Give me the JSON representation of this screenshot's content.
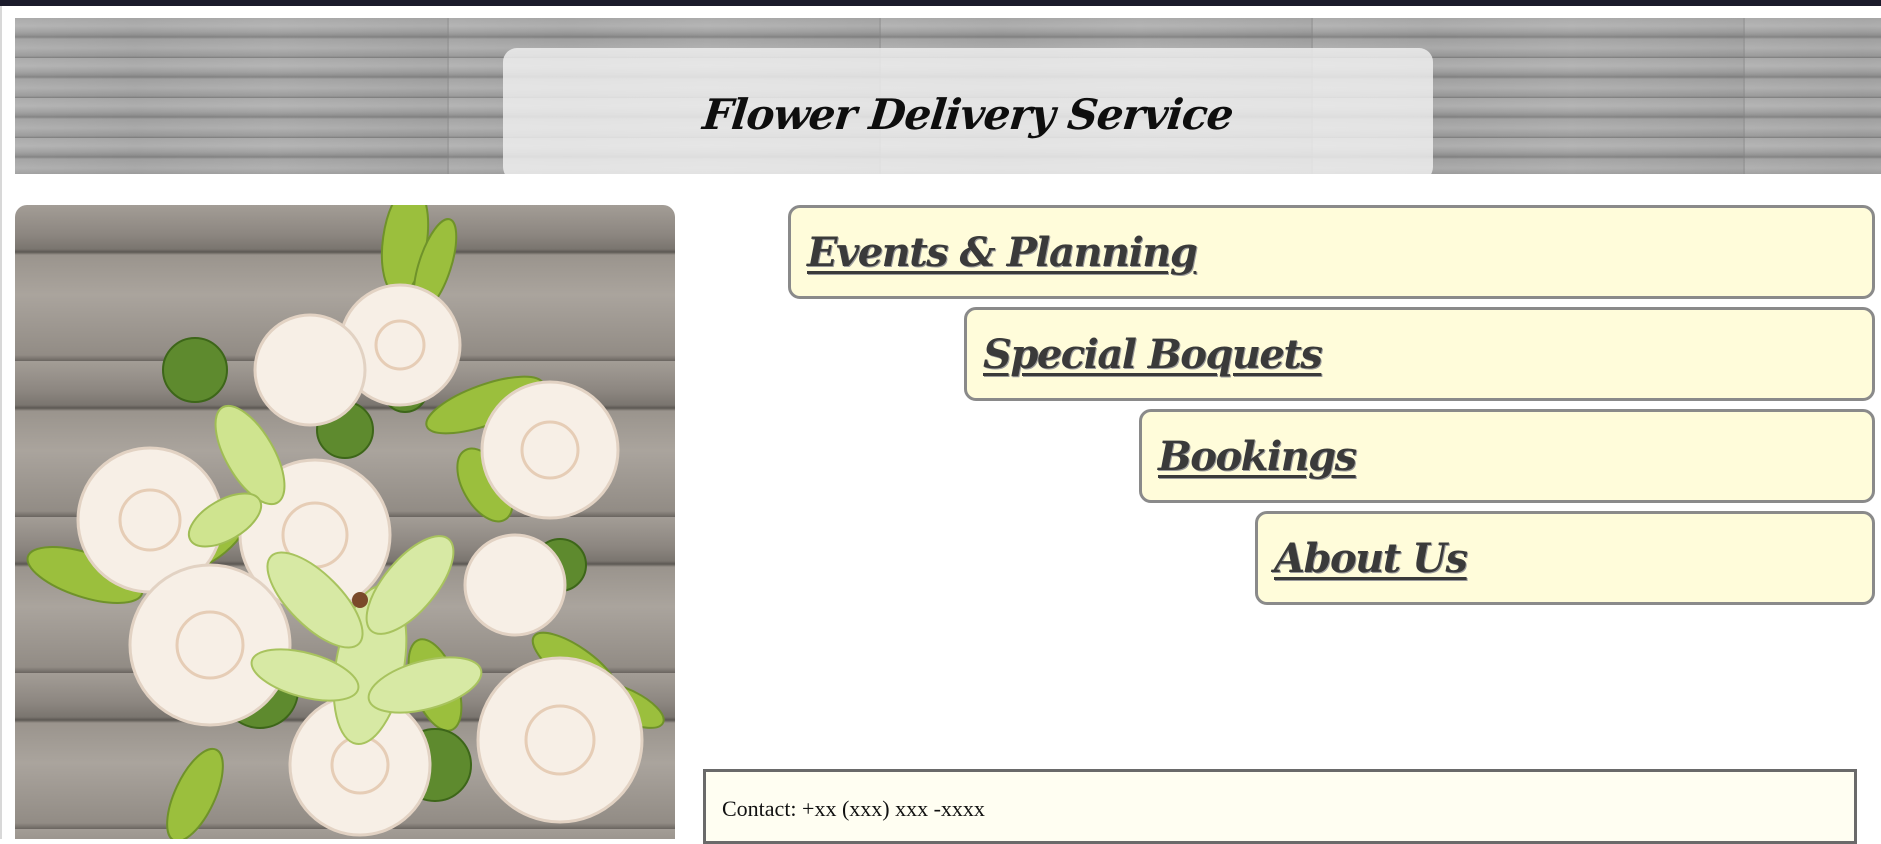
{
  "header": {
    "title": "Flower Delivery Service"
  },
  "hero_image": {
    "alt": "Bouquet of white roses and green lilies on wooden table",
    "icon": "flower-bouquet-photo"
  },
  "nav": {
    "items": [
      {
        "label": "Events & Planning"
      },
      {
        "label": "Special Boquets"
      },
      {
        "label": "Bookings"
      },
      {
        "label": "About Us"
      }
    ]
  },
  "footer": {
    "contact": "Contact: +xx (xxx) xxx -xxxx"
  },
  "colors": {
    "nav_background": "#fffcda",
    "nav_border": "#8a8a8a",
    "top_bar": "#1b1b2b",
    "contact_background": "#fffef2"
  }
}
